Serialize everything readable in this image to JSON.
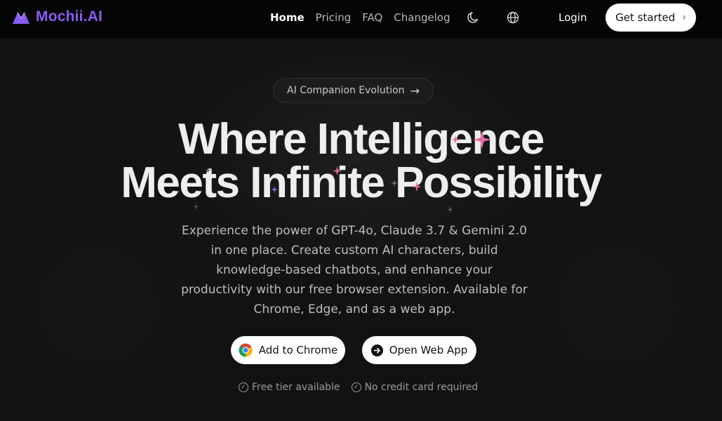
{
  "header": {
    "logo_text": "Mochii.AI",
    "nav": [
      {
        "label": "Home",
        "active": true
      },
      {
        "label": "Pricing",
        "active": false
      },
      {
        "label": "FAQ",
        "active": false
      },
      {
        "label": "Changelog",
        "active": false
      }
    ],
    "theme_icon": "moon-icon",
    "language_icon": "globe-icon",
    "login_label": "Login",
    "get_started_label": "Get started"
  },
  "hero": {
    "pill_label": "AI Companion Evolution",
    "headline_line1": "Where Intelligence",
    "headline_line2": "Meets Infinite Possibility",
    "description": "Experience the power of GPT-4o, Claude 3.7 & Gemini 2.0 in one place. Create custom AI characters, build knowledge-based chatbots, and enhance your productivity with our free browser extension. Available for Chrome, Edge, and as a web app.",
    "cta_chrome_label": "Add to Chrome",
    "cta_web_label": "Open Web App",
    "features": [
      "Free tier available",
      "No credit card required"
    ]
  },
  "colors": {
    "brand": "#8a5cf0",
    "background": "#121212",
    "sparkle_pink": "#e86aa8",
    "sparkle_purple": "#8f6cf0"
  }
}
